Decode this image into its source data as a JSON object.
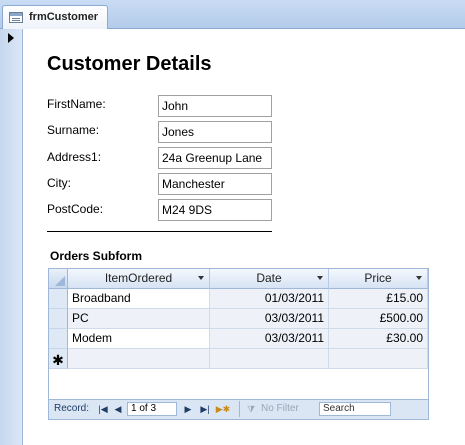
{
  "tab": {
    "title": "frmCustomer"
  },
  "form": {
    "heading": "Customer Details",
    "fields": [
      {
        "label": "FirstName:",
        "value": "John"
      },
      {
        "label": "Surname:",
        "value": "Jones"
      },
      {
        "label": "Address1:",
        "value": "24a Greenup Lane"
      },
      {
        "label": "City:",
        "value": "Manchester"
      },
      {
        "label": "PostCode:",
        "value": "M24 9DS"
      }
    ]
  },
  "subform": {
    "label": "Orders Subform",
    "columns": [
      "ItemOrdered",
      "Date",
      "Price"
    ],
    "rows": [
      {
        "item": "Broadband",
        "date": "01/03/2011",
        "price": "£15.00"
      },
      {
        "item": "PC",
        "date": "03/03/2011",
        "price": "£500.00"
      },
      {
        "item": "Modem",
        "date": "03/03/2011",
        "price": "£30.00"
      }
    ],
    "new_row_marker": "✱",
    "nav": {
      "record_label": "Record:",
      "first": "|◀",
      "prev": "◀",
      "position": "1 of 3",
      "next": "▶",
      "last": "▶|",
      "new": "▶✱",
      "filter": "No Filter",
      "search": "Search"
    }
  }
}
